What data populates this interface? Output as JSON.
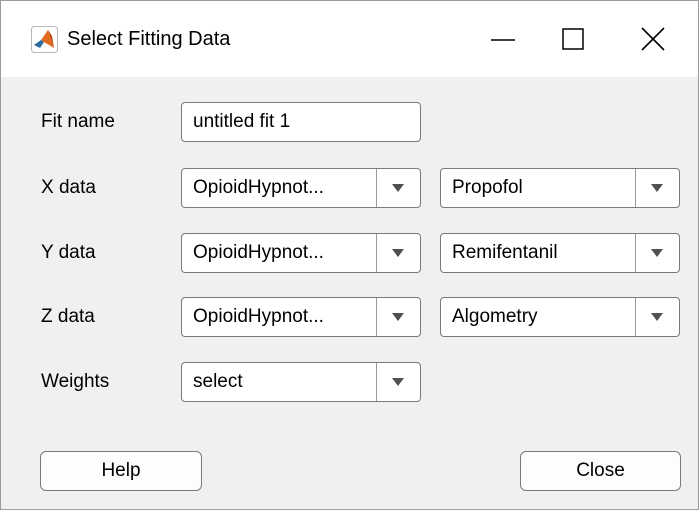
{
  "window": {
    "title": "Select Fitting Data",
    "icon": "matlab-membrane-icon",
    "controls": {
      "minimize_icon": "minimize-icon",
      "maximize_icon": "maximize-icon",
      "close_icon": "close-icon"
    }
  },
  "form": {
    "fit_name": {
      "label": "Fit name",
      "value": "untitled fit 1"
    },
    "x_data": {
      "label": "X data",
      "source": "OpioidHypnot...",
      "variable": "Propofol"
    },
    "y_data": {
      "label": "Y data",
      "source": "OpioidHypnot...",
      "variable": "Remifentanil"
    },
    "z_data": {
      "label": "Z data",
      "source": "OpioidHypnot...",
      "variable": "Algometry"
    },
    "weights": {
      "label": "Weights",
      "value": "select"
    }
  },
  "buttons": {
    "help": "Help",
    "close": "Close"
  },
  "colors": {
    "background": "#f0f0f0",
    "titlebar": "#ffffff",
    "field_border": "#7a7a7a"
  }
}
